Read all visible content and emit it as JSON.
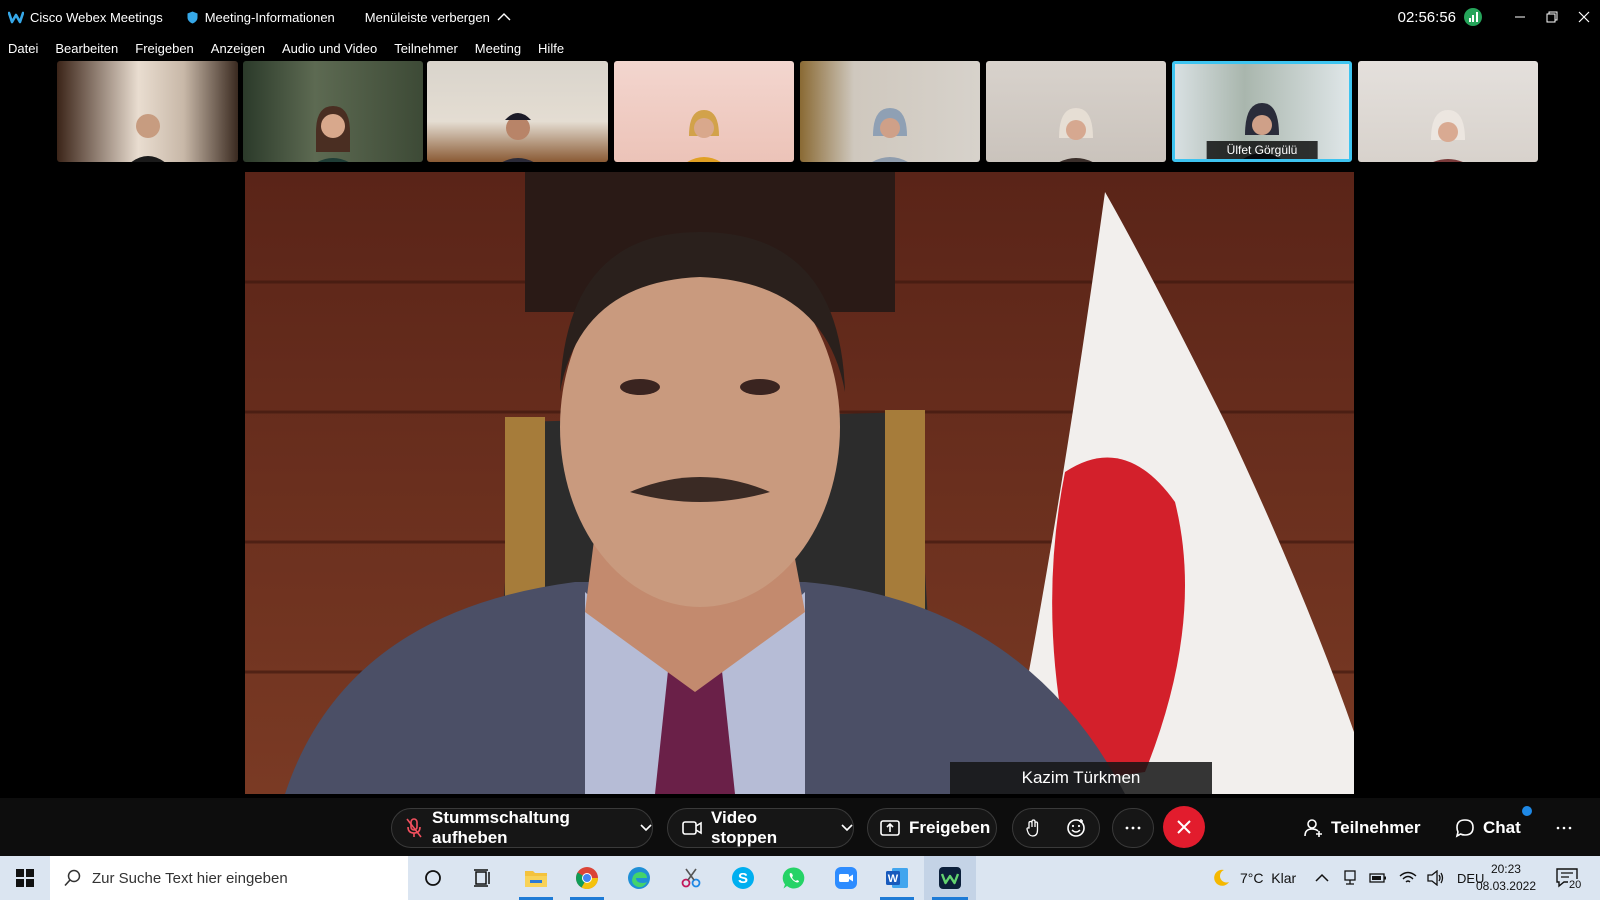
{
  "titlebar": {
    "app_name": "Cisco Webex Meetings",
    "meeting_info": "Meeting-Informationen",
    "hide_menu": "Menüleiste verbergen",
    "time": "02:56:56"
  },
  "menu": {
    "items": [
      "Datei",
      "Bearbeiten",
      "Freigeben",
      "Anzeigen",
      "Audio und Video",
      "Teilnehmer",
      "Meeting",
      "Hilfe"
    ]
  },
  "thumbnails": {
    "active_label": "Ülfet Görgülü"
  },
  "main_video": {
    "speaker_name": "Kazim Türkmen"
  },
  "controls": {
    "unmute": "Stummschaltung aufheben",
    "stop_video": "Video stoppen",
    "share": "Freigeben",
    "participants": "Teilnehmer",
    "chat": "Chat"
  },
  "taskbar": {
    "search_placeholder": "Zur Suche Text hier eingeben",
    "weather": "7°C  Klar",
    "language": "DEU",
    "clock_time": "20:23",
    "clock_date": "08.03.2022",
    "notification_count": "20"
  },
  "colors": {
    "accent_blue": "#3ec4f0",
    "end_call_red": "#e21c2d",
    "signal_green": "#25a45a",
    "taskbar_bg": "#dbe5f1"
  }
}
